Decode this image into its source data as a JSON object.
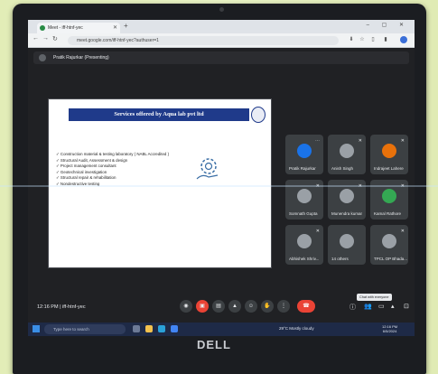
{
  "browser": {
    "tab_title": "Meet - iff-htnf-yec",
    "url": "meet.google.com/iff-htnf-yec?authuser=1"
  },
  "meet": {
    "presenting_label": "Pratik Rajurkar (Presenting)",
    "slide": {
      "title": "Services offered by Aqua lab pvt ltd",
      "items": [
        "Construction material & testing laboratory ( NABL Accredited )",
        "Structural Audit, Assessment & design",
        "Project management consultant",
        "Geotechnical investigation",
        "Structural repair & rehabilitation",
        "Nondestructive testing"
      ]
    },
    "participants": [
      {
        "name": "Pratik Rajurkar",
        "color": "#1a73e8"
      },
      {
        "name": "Anish Singh",
        "color": "#5f6368"
      },
      {
        "name": "Indrajeet Lahere",
        "color": "#e8710a"
      },
      {
        "name": "Somnath Gupta",
        "color": "#5f6368"
      },
      {
        "name": "Munendra kumar",
        "color": "#5f6368"
      },
      {
        "name": "Kamal Rathore",
        "color": "#34a853"
      },
      {
        "name": "Abhishek Shriv...",
        "color": "#5f6368"
      },
      {
        "name": "14 others",
        "color": "#5f6368"
      },
      {
        "name": "TPCL OP Bhada...",
        "color": "#5f6368"
      }
    ],
    "timecode": "12:16 PM | iff-htnf-yec",
    "tooltip": "Chat with everyone"
  },
  "taskbar": {
    "search_placeholder": "Type here to search",
    "weather": "29°C Mostly cloudy",
    "time": "12:16 PM",
    "date": "6/5/2024"
  },
  "brand": "DELL"
}
